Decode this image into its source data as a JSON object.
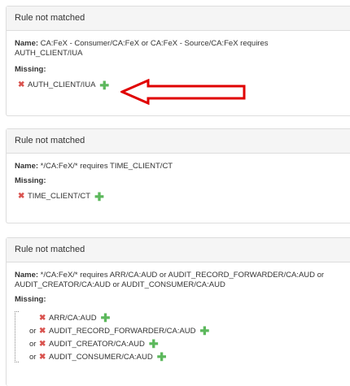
{
  "panels": [
    {
      "header": "Rule not matched",
      "name_label": "Name:",
      "name_text": " CA:FeX - Consumer/CA:FeX or CA:FeX - Source/CA:FeX requires AUTH_CLIENT/IUA",
      "missing_label": "Missing:",
      "items": [
        "AUTH_CLIENT/IUA"
      ]
    },
    {
      "header": "Rule not matched",
      "name_label": "Name:",
      "name_text": " */CA:FeX/* requires TIME_CLIENT/CT",
      "missing_label": "Missing:",
      "items": [
        "TIME_CLIENT/CT"
      ]
    },
    {
      "header": "Rule not matched",
      "name_label": "Name:",
      "name_text": " */CA:FeX/* requires ARR/CA:AUD or AUDIT_RECORD_FORWARDER/CA:AUD or AUDIT_CREATOR/CA:AUD or AUDIT_CONSUMER/CA:AUD",
      "missing_label": "Missing:",
      "or_word": "or",
      "items": [
        "ARR/CA:AUD",
        "AUDIT_RECORD_FORWARDER/CA:AUD",
        "AUDIT_CREATOR/CA:AUD",
        "AUDIT_CONSUMER/CA:AUD"
      ]
    }
  ],
  "icons": {
    "missing": "x-icon",
    "add": "plus-icon"
  },
  "colors": {
    "missing": "#d9534f",
    "add": "#5cb85c",
    "annotation_arrow": "#e00000"
  },
  "glyphs": {
    "x": "✖",
    "plus": "✚"
  }
}
